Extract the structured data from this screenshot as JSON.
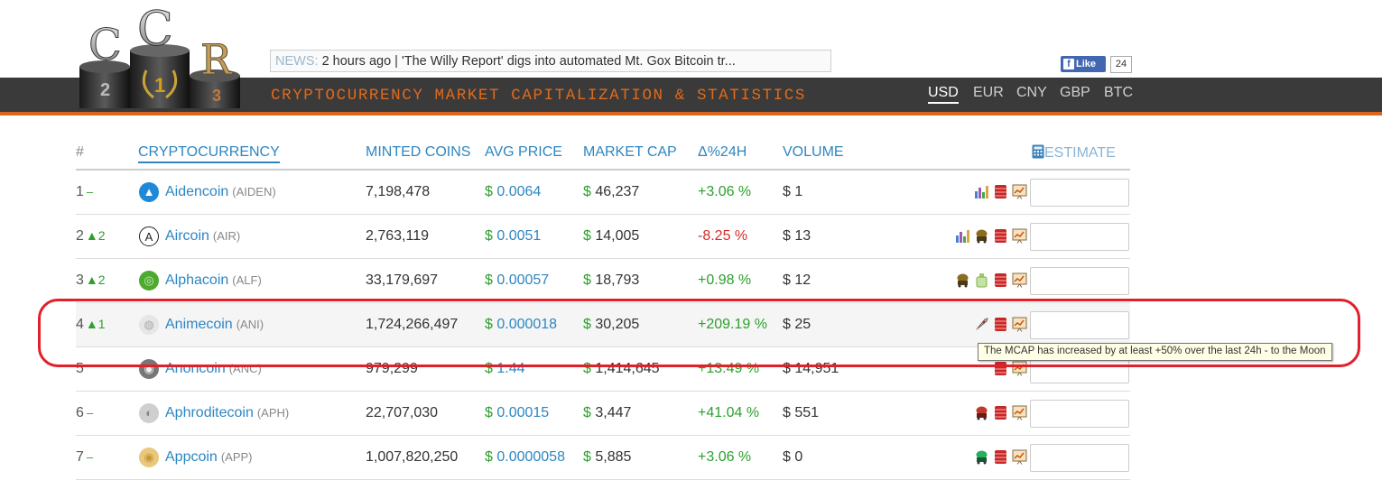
{
  "logo": {
    "letters": [
      "C",
      "C",
      "R"
    ],
    "places": [
      "2",
      "1",
      "3"
    ]
  },
  "tagline": "CRYPTOCURRENCY MARKET CAPITALIZATION & STATISTICS",
  "news": {
    "label": "NEWS:",
    "text": "2 hours ago | 'The Willy Report' digs into automated Mt. Gox Bitcoin tr..."
  },
  "facebook": {
    "like_label": "Like",
    "count": "24"
  },
  "currencies": [
    "USD",
    "EUR",
    "CNY",
    "GBP",
    "BTC"
  ],
  "selected_currency": "USD",
  "table": {
    "headers": {
      "rank": "#",
      "crypto": "CRYPTOCURRENCY",
      "minted": "MINTED COINS",
      "price": "AVG PRICE",
      "mcap": "MARKET CAP",
      "change": "Δ%24H",
      "volume": "VOLUME",
      "estimate": "ESTIMATE"
    },
    "rows": [
      {
        "rank": "1",
        "move": "–",
        "name": "Aidencoin",
        "symbol": "(AIDEN)",
        "minted": "7,198,478",
        "price": "0.0064",
        "mcap": "46,237",
        "change": "+3.06 %",
        "volume": "$ 1"
      },
      {
        "rank": "2",
        "move": "▲2",
        "name": "Aircoin",
        "symbol": "(AIR)",
        "minted": "2,763,119",
        "price": "0.0051",
        "mcap": "14,005",
        "change": "-8.25 %",
        "volume": "$ 13"
      },
      {
        "rank": "3",
        "move": "▲2",
        "name": "Alphacoin",
        "symbol": "(ALF)",
        "minted": "33,179,697",
        "price": "0.00057",
        "mcap": "18,793",
        "change": "+0.98 %",
        "volume": "$ 12"
      },
      {
        "rank": "4",
        "move": "▲1",
        "name": "Animecoin",
        "symbol": "(ANI)",
        "minted": "1,724,266,497",
        "price": "0.000018",
        "mcap": "30,205",
        "change": "+209.19 %",
        "volume": "$ 25"
      },
      {
        "rank": "5",
        "move": "",
        "name": "Anoncoin",
        "symbol": "(ANC)",
        "minted": "979,299",
        "price": "1.44",
        "mcap": "1,414,645",
        "change": "+13.49 %",
        "volume": "$ 14,951"
      },
      {
        "rank": "6",
        "move": "–",
        "name": "Aphroditecoin",
        "symbol": "(APH)",
        "minted": "22,707,030",
        "price": "0.00015",
        "mcap": "3,447",
        "change": "+41.04 %",
        "volume": "$ 551"
      },
      {
        "rank": "7",
        "move": "–",
        "name": "Appcoin",
        "symbol": "(APP)",
        "minted": "1,007,820,250",
        "price": "0.0000058",
        "mcap": "5,885",
        "change": "+3.06 %",
        "volume": "$ 0"
      }
    ]
  },
  "tooltip": "The MCAP has increased by at least +50% over the last 24h - to the Moon",
  "colors": {
    "accent": "#2e86c1",
    "positive": "#2da02d",
    "negative": "#d62b2b",
    "brand_orange": "#e06a1c",
    "highlight": "#e0202a"
  }
}
